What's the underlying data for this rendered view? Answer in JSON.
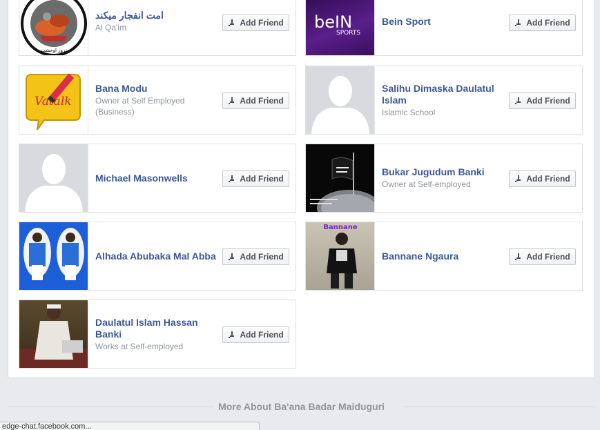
{
  "add_friend_label": "Add Friend",
  "friends": [
    {
      "name": "امت انفجار میکند",
      "subtitle": "Al Qa'im",
      "avatar": "logo-emblem-image"
    },
    {
      "name": "Bein Sport",
      "subtitle": "",
      "avatar": "bein-sports-logo"
    },
    {
      "name": "Bana Modu",
      "subtitle_prefix": "Owner at ",
      "subtitle_org": "Self Employed (Business)",
      "avatar": "vatalk-logo"
    },
    {
      "name": "Salihu Dimaska Daulatul Islam",
      "subtitle": "Islamic School",
      "avatar": "default-silhouette"
    },
    {
      "name": "Michael Masonwells",
      "subtitle": "",
      "avatar": "default-silhouette"
    },
    {
      "name": "Bukar Jugudum Banki",
      "subtitle_prefix": "Owner at ",
      "subtitle_org": "Self-employed",
      "avatar": "flag-photo"
    },
    {
      "name": "Alhada Abubaka Mal Abba",
      "subtitle": "",
      "avatar": "jersey-photo"
    },
    {
      "name": "Bannane Ngaura",
      "subtitle": "",
      "avatar": "person-photo",
      "avatar_caption": "Bannane"
    },
    {
      "name": "Daulatul Islam Hassan Banki",
      "subtitle_prefix": "Works at ",
      "subtitle_org": "Self-employed",
      "avatar": "seated-man-photo"
    }
  ],
  "bein": {
    "word": "beIN",
    "sub": "SPORTS"
  },
  "emblem": {
    "text": "ترور اوحشت"
  },
  "section_title": "More About Ba'ana Badar Maiduguri",
  "status_url": "edge-chat.facebook.com...",
  "colors": {
    "link": "#3b5998",
    "muted": "#90949c",
    "bein_purple": "#4a1a7a"
  }
}
